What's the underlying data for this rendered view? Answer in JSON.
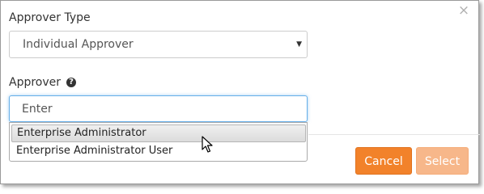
{
  "dialog": {
    "close_glyph": "×",
    "approver_type": {
      "label": "Approver Type",
      "selected": "Individual Approver",
      "caret_glyph": "▼"
    },
    "approver": {
      "label": "Approver",
      "help_glyph": "?",
      "placeholder": "Enter",
      "suggestions": [
        "Enterprise Administrator",
        "Enterprise Administrator User"
      ]
    },
    "buttons": {
      "cancel_label": "Cancel",
      "select_label": "Select"
    }
  },
  "colors": {
    "accent": "#f2822a",
    "accent_disabled": "#f7b78a",
    "focus_border": "#66afe9"
  }
}
